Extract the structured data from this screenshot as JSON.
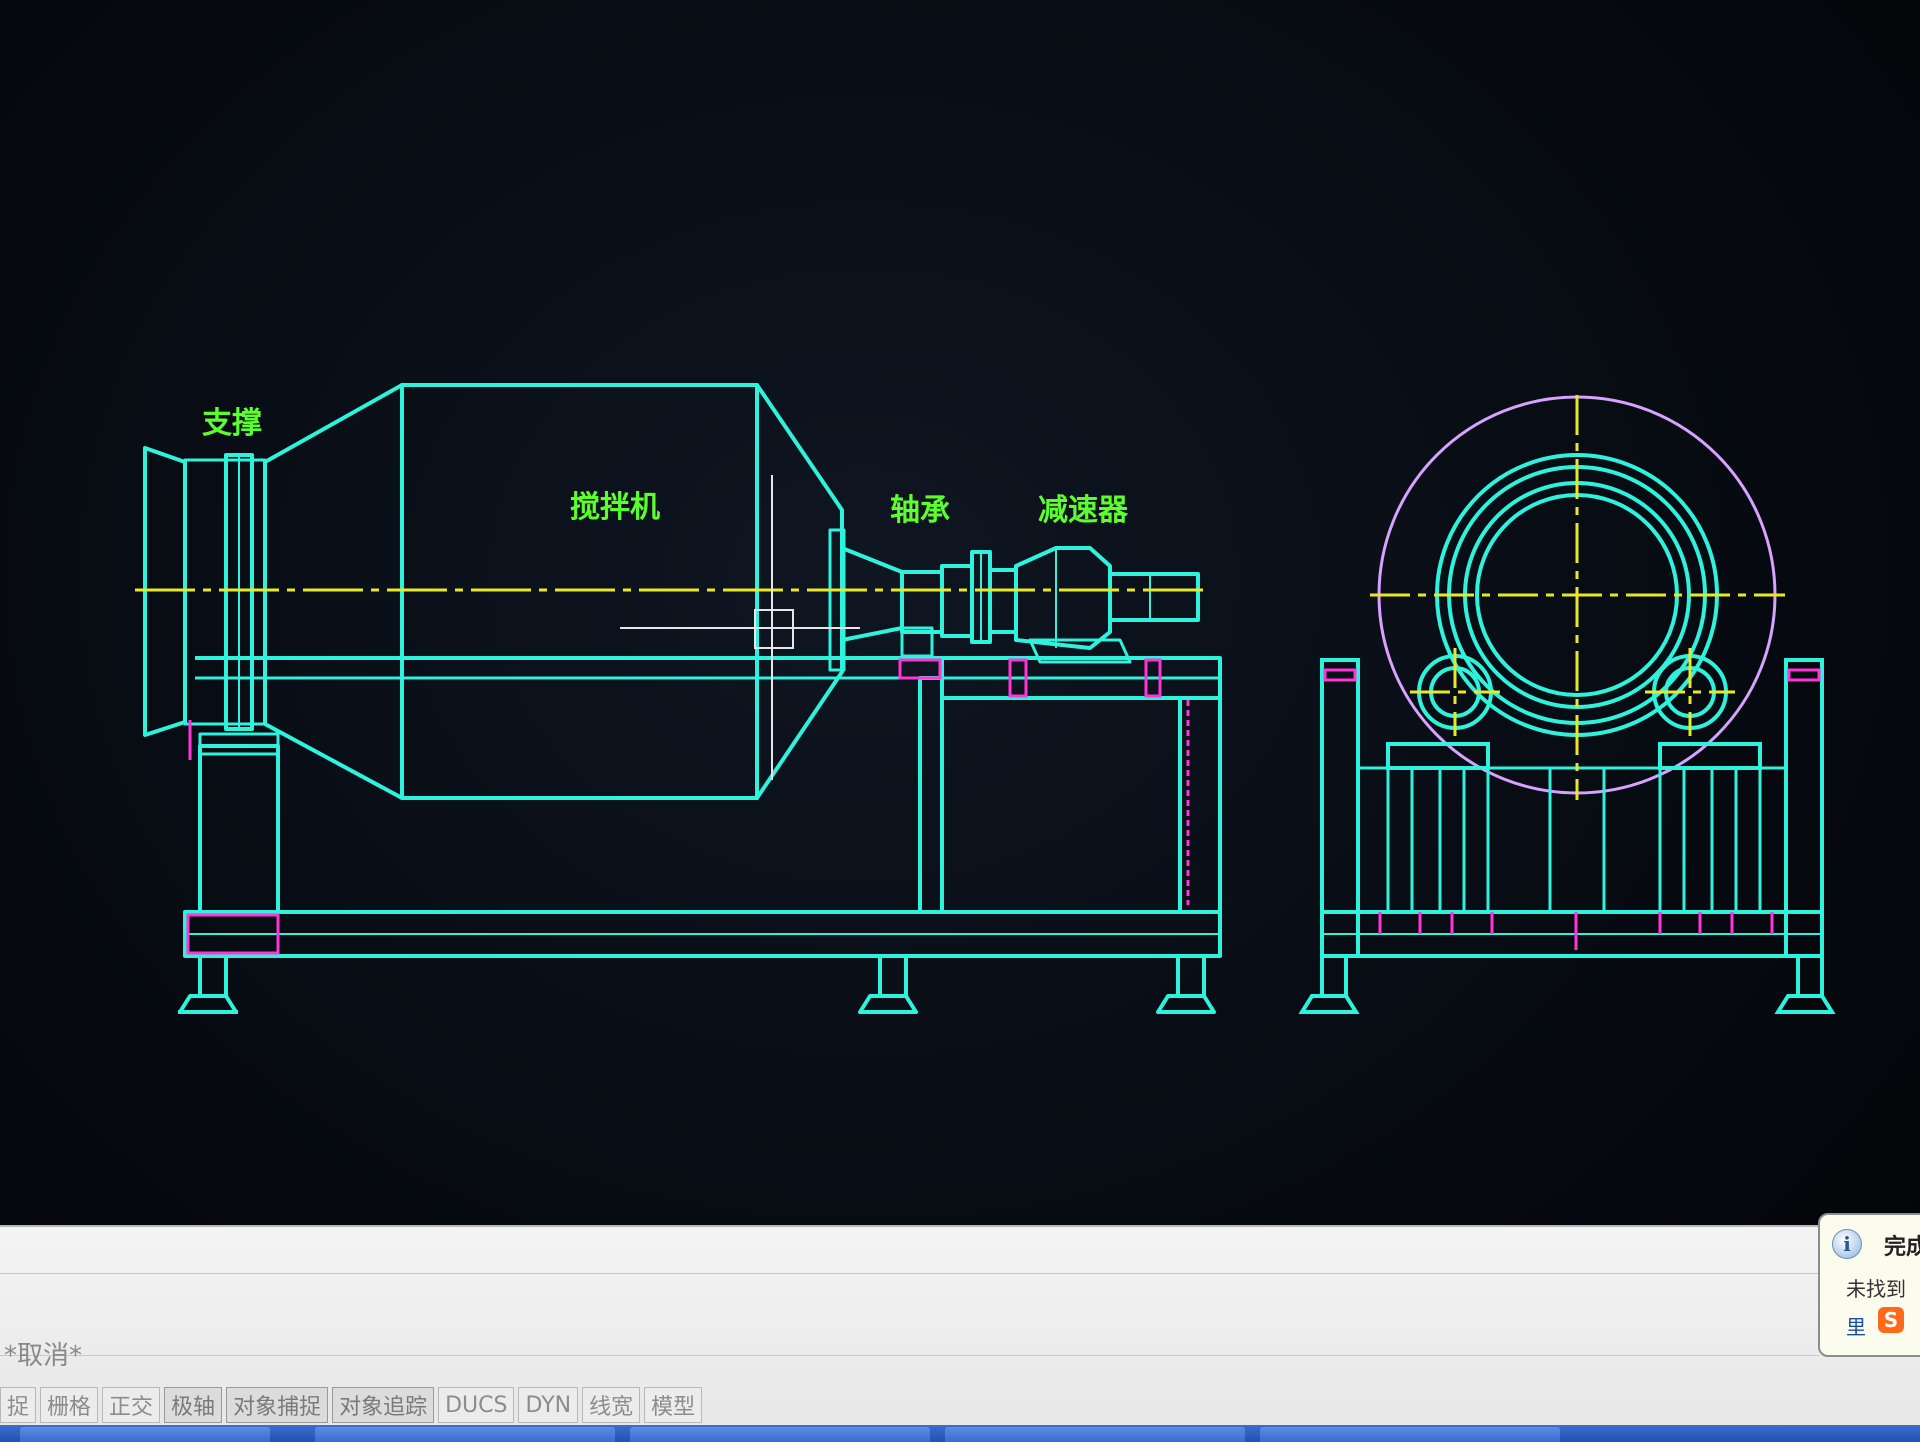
{
  "drawing": {
    "labels": {
      "support": "支撑",
      "mixer": "搅拌机",
      "bearing": "轴承",
      "reducer": "减速器"
    },
    "colors": {
      "background": "#06090f",
      "outline": "#2ef2dc",
      "center_line": "#e8e82a",
      "hidden_line": "#ff35d6",
      "label": "#5cff2e"
    }
  },
  "command": {
    "line_text": "*取消*"
  },
  "status_bar": {
    "buttons": [
      {
        "label": "捉",
        "on": false
      },
      {
        "label": "栅格",
        "on": false
      },
      {
        "label": "正交",
        "on": false
      },
      {
        "label": "极轴",
        "on": true
      },
      {
        "label": "对象捕捉",
        "on": true
      },
      {
        "label": "对象追踪",
        "on": true
      },
      {
        "label": "DUCS",
        "on": false
      },
      {
        "label": "DYN",
        "on": false
      },
      {
        "label": "线宽",
        "on": false
      },
      {
        "label": "模型",
        "on": false
      }
    ]
  },
  "notification": {
    "info_icon": "info-icon",
    "title": "完成",
    "message": "未找到",
    "app_text": "里",
    "app_icon": "S"
  }
}
